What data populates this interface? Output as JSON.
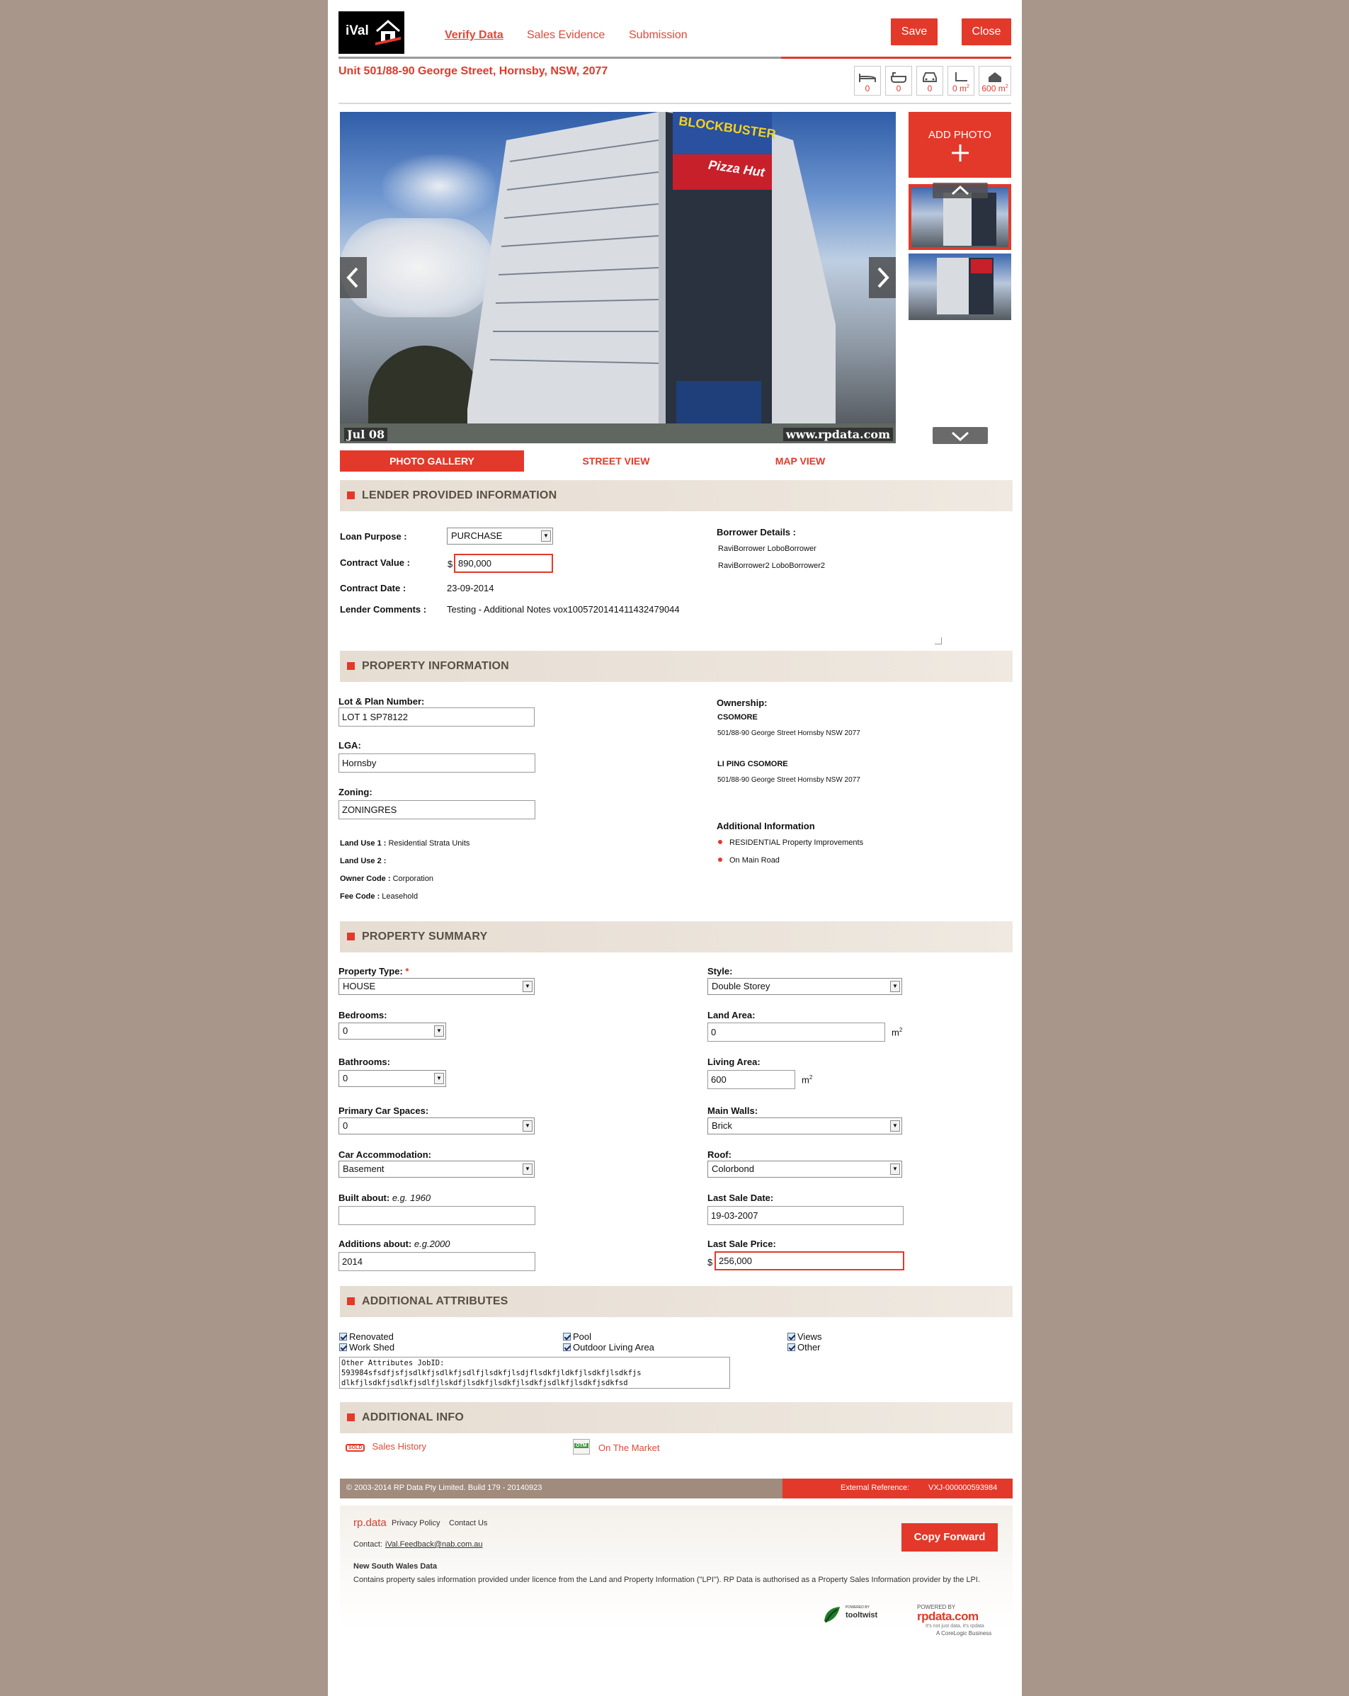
{
  "app": {
    "logo_text": "iVal"
  },
  "nav": {
    "tabs": [
      "Verify Data",
      "Sales Evidence",
      "Submission"
    ],
    "save": "Save",
    "close": "Close"
  },
  "address": "Unit 501/88-90 George Street, Hornsby, NSW, 2077",
  "property_icons": [
    {
      "icon": "bed-icon",
      "value": "0"
    },
    {
      "icon": "bath-icon",
      "value": "0"
    },
    {
      "icon": "car-icon",
      "value": "0"
    },
    {
      "icon": "land-area-icon",
      "value": "0 m",
      "sup": "2"
    },
    {
      "icon": "house-area-icon",
      "value": "600 m",
      "sup": "2"
    }
  ],
  "photo": {
    "date_stamp": "Jul 08",
    "watermark": "www.rpdata.com",
    "signs": [
      "BLOCKBUSTER",
      "Pizza Hut"
    ],
    "add_photo": "ADD PHOTO"
  },
  "view_tabs": [
    "PHOTO GALLERY",
    "STREET VIEW",
    "MAP VIEW"
  ],
  "lender": {
    "title": "LENDER PROVIDED INFORMATION",
    "loan_purpose_label": "Loan Purpose :",
    "loan_purpose": "PURCHASE",
    "contract_value_label": "Contract Value :",
    "currency": "$",
    "contract_value": "890,000",
    "contract_date_label": "Contract Date :",
    "contract_date": "23-09-2014",
    "comments_label": "Lender Comments :",
    "comments": "Testing - Additional Notes vox1005720141411432479044",
    "borrower_label": "Borrower Details :",
    "borrowers": [
      "RaviBorrower LoboBorrower",
      "RaviBorrower2 LoboBorrower2"
    ]
  },
  "property_info": {
    "title": "PROPERTY INFORMATION",
    "lot_label": "Lot & Plan Number:",
    "lot": "LOT 1 SP78122",
    "lga_label": "LGA:",
    "lga": "Hornsby",
    "zoning_label": "Zoning:",
    "zoning": "ZONINGRES",
    "land_use1_label": "Land Use 1 :",
    "land_use1": "Residential Strata Units",
    "land_use2_label": "Land Use 2 :",
    "owner_code_label": "Owner Code :",
    "owner_code": "Corporation",
    "fee_code_label": "Fee Code :",
    "fee_code": "Leasehold",
    "ownership_label": "Ownership:",
    "owners": [
      {
        "name": "CSOMORE",
        "address": "501/88-90 George Street Hornsby NSW 2077"
      },
      {
        "name": "LI PING CSOMORE",
        "address": "501/88-90 George Street Hornsby NSW 2077"
      }
    ],
    "additional_label": "Additional Information",
    "additional": [
      "RESIDENTIAL Property Improvements",
      "On Main Road"
    ]
  },
  "summary": {
    "title": "PROPERTY SUMMARY",
    "property_type_label": "Property Type:",
    "required_mark": "*",
    "property_type": "HOUSE",
    "bedrooms_label": "Bedrooms:",
    "bedrooms": "0",
    "bathrooms_label": "Bathrooms:",
    "bathrooms": "0",
    "car_spaces_label": "Primary Car Spaces:",
    "car_spaces": "0",
    "car_accom_label": "Car Accommodation:",
    "car_accom": "Basement",
    "built_label": "Built about:",
    "built_hint": "e.g. 1960",
    "built": "",
    "additions_label": "Additions about:",
    "additions_hint": "e.g.2000",
    "additions": "2014",
    "style_label": "Style:",
    "style": "Double Storey",
    "land_area_label": "Land Area:",
    "land_area": "0",
    "living_area_label": "Living Area:",
    "living_area": "600",
    "unit": "m",
    "unit_sup": "2",
    "walls_label": "Main Walls:",
    "walls": "Brick",
    "roof_label": "Roof:",
    "roof": "Colorbond",
    "last_sale_date_label": "Last Sale Date:",
    "last_sale_date": "19-03-2007",
    "last_sale_price_label": "Last Sale Price:",
    "currency": "$",
    "last_sale_price": "256,000"
  },
  "attributes": {
    "title": "ADDITIONAL ATTRIBUTES",
    "items": [
      "Renovated",
      "Work Shed",
      "Pool",
      "Outdoor Living Area",
      "Views",
      "Other"
    ],
    "other_text": "Other Attributes JobID:\n593984sfsdfjsfjsdlkfjsdlkfjsdlfjlsdkfjlsdjflsdkfjldkfjlsdkfjlsdkfjs\ndlkfjlsdkfjsdlkfjsdlfjlskdfjlsdkfjlsdkfjlsdkfjsdlkfjlsdkfjsdkfsd"
  },
  "additional_info": {
    "title": "ADDITIONAL INFO",
    "sales_badge": "SOLD",
    "sales_history": "Sales History",
    "otm_badge": "OTM",
    "on_market": "On The Market"
  },
  "footer": {
    "copyright": "© 2003-2014 RP Data Pty Limited. Build 179 - 20140923",
    "ext_ref_label": "External Reference:",
    "ext_ref": "VXJ-000000593984",
    "brand": "rp.data",
    "privacy": "Privacy Policy",
    "contact_us": "Contact Us",
    "contact_label": "Contact:",
    "contact_email": "iVal.Feedback@nab.com.au",
    "copy_forward": "Copy Forward",
    "nsw_title": "New South Wales Data",
    "nsw_text": "Contains property sales information provided under licence from the Land and Property Information (\"LPI\"). RP Data is authorised as a Property Sales Information provider by the LPI.",
    "powered_by_1": "POWERED BY",
    "tooltwist": "tooltwist",
    "powered_by_2": "POWERED BY",
    "rpdata_logo": "rpdata.com",
    "rpdata_tag": "It's not just data, it's rpdata",
    "corelogic": "A CoreLogic Business"
  },
  "colors": {
    "accent": "#e2392a",
    "background": "#a79689",
    "section_bar": "#e6ddd2",
    "footer_bar": "#a08b7c"
  }
}
